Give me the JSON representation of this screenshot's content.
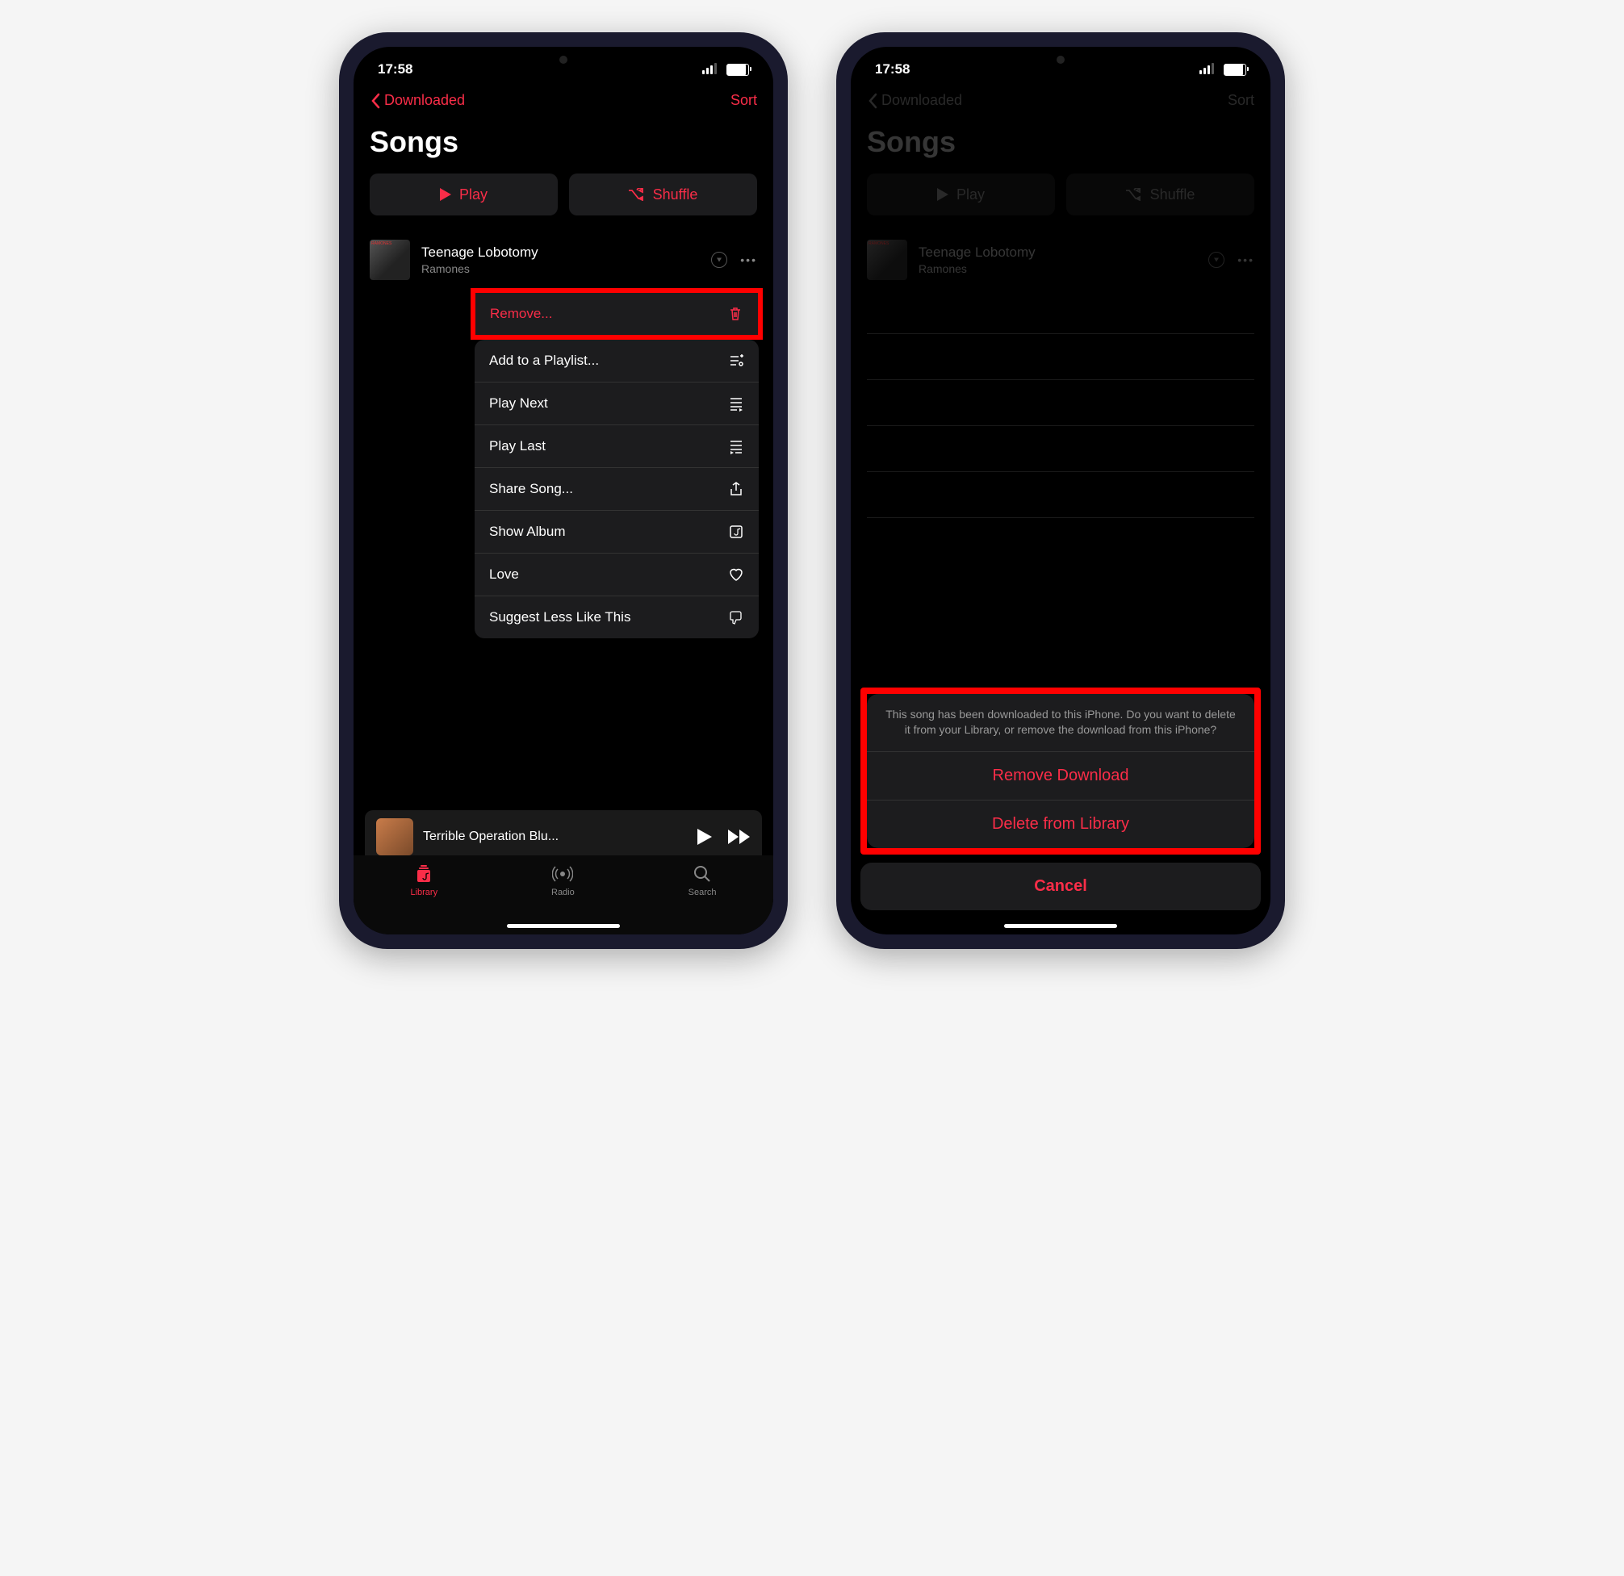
{
  "status": {
    "time": "17:58"
  },
  "nav": {
    "back": "Downloaded",
    "sort": "Sort"
  },
  "page": {
    "title": "Songs"
  },
  "buttons": {
    "play": "Play",
    "shuffle": "Shuffle"
  },
  "song": {
    "title": "Teenage Lobotomy",
    "artist": "Ramones"
  },
  "menu": {
    "remove": "Remove...",
    "addPlaylist": "Add to a Playlist...",
    "playNext": "Play Next",
    "playLast": "Play Last",
    "share": "Share Song...",
    "showAlbum": "Show Album",
    "love": "Love",
    "suggestLess": "Suggest Less Like This"
  },
  "nowPlaying": {
    "title": "Terrible Operation Blu..."
  },
  "tabs": {
    "library": "Library",
    "radio": "Radio",
    "search": "Search"
  },
  "sheet": {
    "message": "This song has been downloaded to this iPhone. Do you want to delete it from your Library, or remove the download from this iPhone?",
    "removeDownload": "Remove Download",
    "deleteLibrary": "Delete from Library",
    "cancel": "Cancel"
  }
}
